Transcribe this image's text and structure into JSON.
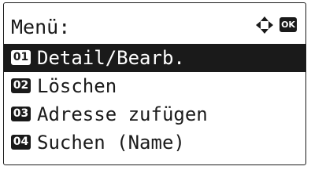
{
  "header": {
    "title": "Menü:",
    "nav_icon": "four-way-arrow-icon",
    "ok_label": "OK"
  },
  "menu": {
    "selected_index": 0,
    "items": [
      {
        "number": "01",
        "label": "Detail/Bearb."
      },
      {
        "number": "02",
        "label": "Löschen"
      },
      {
        "number": "03",
        "label": "Adresse zufügen"
      },
      {
        "number": "04",
        "label": "Suchen (Name)"
      }
    ]
  },
  "colors": {
    "foreground": "#1a1a1a",
    "background": "#ffffff"
  }
}
